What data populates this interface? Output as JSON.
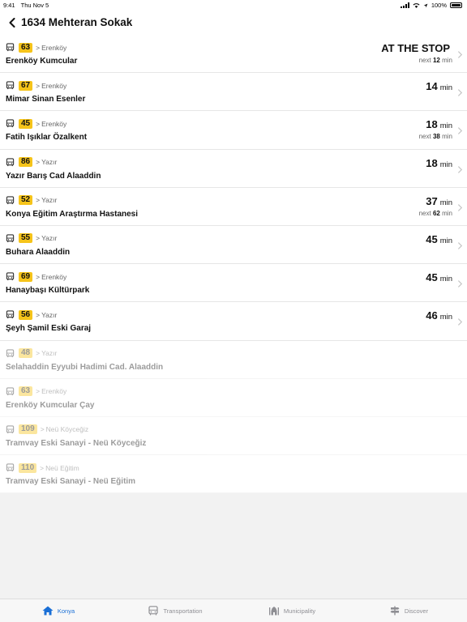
{
  "status_bar": {
    "time": "9:41",
    "date": "Thu Nov 5",
    "battery": "100%"
  },
  "header": {
    "title": "1634 Mehteran Sokak"
  },
  "colors": {
    "badge": "#f6c41a",
    "tab_active": "#1a6fd6",
    "tab_inactive": "#8e8e93"
  },
  "rows": [
    {
      "route": "63",
      "arrow": ">",
      "direction": "Erenköy",
      "name": "Erenköy Kumcular",
      "eta": "AT THE STOP",
      "eta_unit": "",
      "next_label": "next",
      "next_value": "12",
      "next_unit": "min",
      "active": true
    },
    {
      "route": "67",
      "arrow": ">",
      "direction": "Erenköy",
      "name": "Mimar Sinan Esenler",
      "eta": "14",
      "eta_unit": "min",
      "next_label": "",
      "next_value": "",
      "next_unit": "",
      "active": true
    },
    {
      "route": "45",
      "arrow": ">",
      "direction": "Erenköy",
      "name": "Fatih Işıklar Özalkent",
      "eta": "18",
      "eta_unit": "min",
      "next_label": "next",
      "next_value": "38",
      "next_unit": "min",
      "active": true
    },
    {
      "route": "86",
      "arrow": ">",
      "direction": "Yazır",
      "name": "Yazır Barış Cad Alaaddin",
      "eta": "18",
      "eta_unit": "min",
      "next_label": "",
      "next_value": "",
      "next_unit": "",
      "active": true
    },
    {
      "route": "52",
      "arrow": ">",
      "direction": "Yazır",
      "name": "Konya Eğitim Araştırma Hastanesi",
      "eta": "37",
      "eta_unit": "min",
      "next_label": "next",
      "next_value": "62",
      "next_unit": "min",
      "active": true
    },
    {
      "route": "55",
      "arrow": ">",
      "direction": "Yazır",
      "name": "Buhara Alaaddin",
      "eta": "45",
      "eta_unit": "min",
      "next_label": "",
      "next_value": "",
      "next_unit": "",
      "active": true
    },
    {
      "route": "69",
      "arrow": ">",
      "direction": "Erenköy",
      "name": "Hanaybaşı Kültürpark",
      "eta": "45",
      "eta_unit": "min",
      "next_label": "",
      "next_value": "",
      "next_unit": "",
      "active": true
    },
    {
      "route": "56",
      "arrow": ">",
      "direction": "Yazır",
      "name": "Şeyh Şamil Eski Garaj",
      "eta": "46",
      "eta_unit": "min",
      "next_label": "",
      "next_value": "",
      "next_unit": "",
      "active": true
    },
    {
      "route": "48",
      "arrow": ">",
      "direction": "Yazır",
      "name": "Selahaddin Eyyubi Hadimi Cad. Alaaddin",
      "eta": "",
      "eta_unit": "",
      "next_label": "",
      "next_value": "",
      "next_unit": "",
      "active": false
    },
    {
      "route": "63",
      "arrow": ">",
      "direction": "Erenköy",
      "name": "Erenköy Kumcular Çay",
      "eta": "",
      "eta_unit": "",
      "next_label": "",
      "next_value": "",
      "next_unit": "",
      "active": false
    },
    {
      "route": "109",
      "arrow": ">",
      "direction": "Neü Köyceğiz",
      "name": "Tramvay Eski Sanayi - Neü Köyceğiz",
      "eta": "",
      "eta_unit": "",
      "next_label": "",
      "next_value": "",
      "next_unit": "",
      "active": false
    },
    {
      "route": "110",
      "arrow": ">",
      "direction": "Neü Eğitim",
      "name": "Tramvay Eski Sanayi - Neü Eğitim",
      "eta": "",
      "eta_unit": "",
      "next_label": "",
      "next_value": "",
      "next_unit": "",
      "active": false
    }
  ],
  "tabs": [
    {
      "label": "Konya",
      "icon": "home-icon",
      "active": true
    },
    {
      "label": "Transportation",
      "icon": "bus-icon",
      "active": false
    },
    {
      "label": "Municipality",
      "icon": "mosque-icon",
      "active": false
    },
    {
      "label": "Discover",
      "icon": "signpost-icon",
      "active": false
    }
  ]
}
